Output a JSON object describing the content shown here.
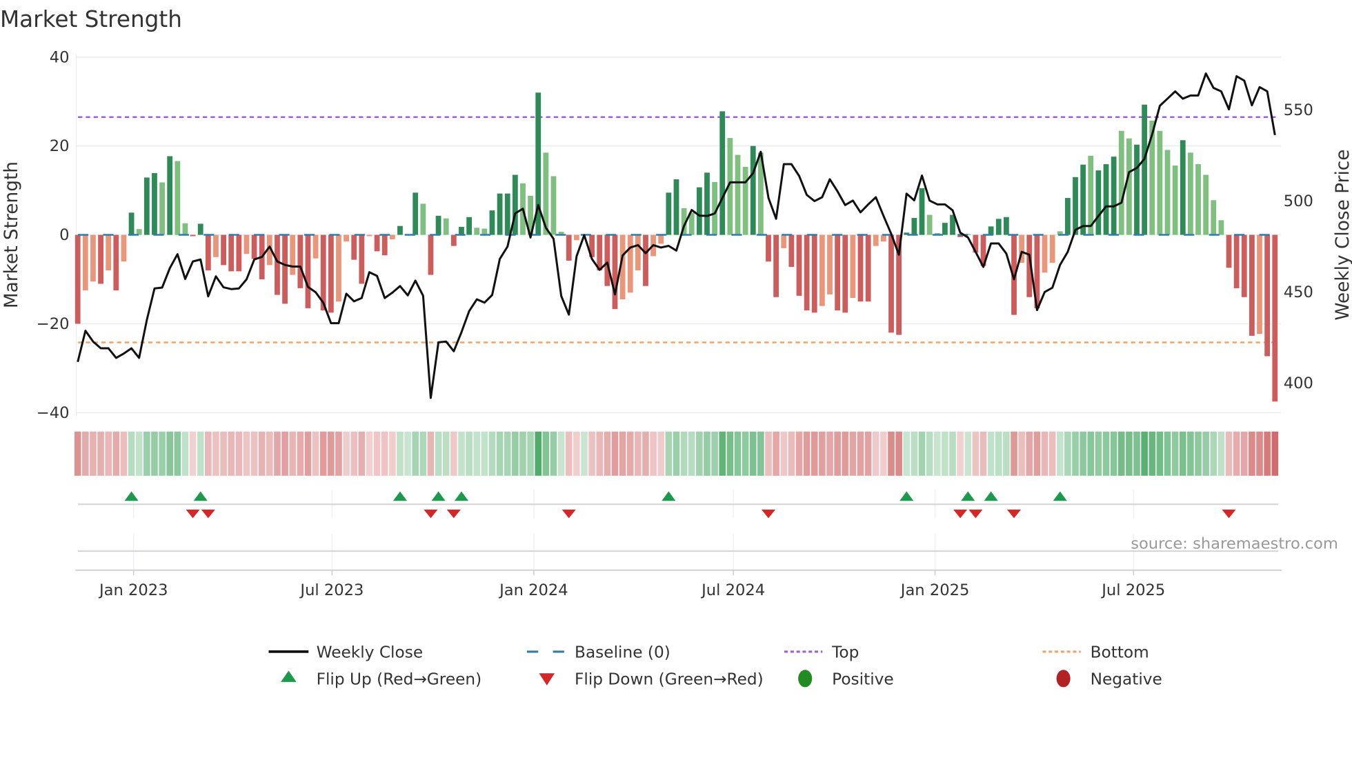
{
  "chart_data": {
    "type": "bar",
    "title": "Market Strength",
    "ylabel": "Market Strength",
    "y2label": "Weekly Close Price",
    "ylim": [
      -40,
      40
    ],
    "y2lim": [
      385,
      580
    ],
    "yticks": [
      40,
      20,
      0,
      -20,
      -40
    ],
    "y2ticks": [
      550,
      500,
      450,
      400
    ],
    "xticks": [
      {
        "label": "Jan 2023",
        "date": "2023-01-01"
      },
      {
        "label": "Jul 2023",
        "date": "2023-07-01"
      },
      {
        "label": "Jan 2024",
        "date": "2024-01-01"
      },
      {
        "label": "Jul 2024",
        "date": "2024-07-01"
      },
      {
        "label": "Jan 2025",
        "date": "2025-01-01"
      },
      {
        "label": "Jul 2025",
        "date": "2025-07-01"
      }
    ],
    "start_date": "2022-11-11",
    "interval": "weekly",
    "top_level": 26.5,
    "bottom_level": -24.2,
    "baseline": 0,
    "strength": [
      -20,
      -12.5,
      -10.5,
      -11,
      -8,
      -12.5,
      -6,
      5,
      1.3,
      12.9,
      13.9,
      11.8,
      17.7,
      16.6,
      2.6,
      -0.3,
      2.5,
      -8,
      -5,
      -6.8,
      -8.2,
      -8.2,
      -4.3,
      -5.4,
      -10,
      -6.8,
      -13.5,
      -15.5,
      -9,
      -12,
      -16.5,
      -5.3,
      -17,
      -17.5,
      -15,
      -1.5,
      -5.6,
      -11,
      -0.3,
      -3.7,
      -4.6,
      -1,
      2,
      0,
      9.5,
      7,
      -9,
      4.3,
      3.7,
      -2.5,
      1.8,
      4,
      1.6,
      1.4,
      5.5,
      9.3,
      9.3,
      13.5,
      11.6,
      8.8,
      32,
      18.5,
      13.2,
      0.7,
      -5.8,
      -1.2,
      0,
      -5,
      -8,
      -11.5,
      -16.7,
      -14.5,
      -13,
      -8,
      -11.5,
      -4.8,
      -2,
      9.5,
      12.5,
      6,
      5,
      10.7,
      14,
      11.9,
      27.8,
      21.8,
      18,
      15.3,
      20,
      18.5,
      -6,
      -14,
      -3,
      -7.2,
      -13.7,
      -17,
      -17.5,
      -16,
      -13.4,
      -17,
      -17.5,
      -14.2,
      -15,
      -15,
      -2.5,
      -1.5,
      -22,
      -22.5,
      0.5,
      3.8,
      10.5,
      4.5,
      0.4,
      2.7,
      4.5,
      -0.5,
      0.2,
      -4,
      -7,
      1.9,
      3.6,
      4,
      -18,
      -6.3,
      -14,
      -16.5,
      -8.5,
      -6.3,
      0.8,
      8.3,
      13,
      15.8,
      17.8,
      14.5,
      15.9,
      17.6,
      23.4,
      21.7,
      20.3,
      29.3,
      25.7,
      23.4,
      19.1,
      15.6,
      21.3,
      18.5,
      15.9,
      13.5,
      7.8,
      3.3,
      -7.4,
      -12,
      -14,
      -22.7,
      -22.3,
      -27.3,
      -37.5
    ],
    "strength_shade": "dlldldldlddldlldddldddlddlddlddlddllddlddldddlddldddllddddlldllldldddddllldllddllddldllldlddlddddllddlddlldddddlldddlddddddlddllldddldddllddlllldlllllddddldd",
    "weekly_close": [
      411.6,
      428.7,
      422.8,
      419.1,
      419.1,
      413.8,
      416.2,
      419.1,
      413.8,
      434.6,
      452,
      452.5,
      463.2,
      470.8,
      457.2,
      466.8,
      467.9,
      447.6,
      458.6,
      452.6,
      451.6,
      452,
      457,
      467.9,
      469.3,
      475,
      466.8,
      464.9,
      464,
      464,
      452.8,
      449.9,
      444.1,
      432.9,
      432.9,
      449.1,
      444.9,
      446.7,
      460.9,
      458.9,
      446.7,
      449.7,
      453.3,
      448.2,
      456.3,
      448,
      391.8,
      422.4,
      422.8,
      417.5,
      428,
      439.5,
      446,
      444.2,
      448.4,
      468.2,
      475,
      493.2,
      495.8,
      480,
      497.8,
      485.3,
      479.3,
      447.8,
      437.6,
      469.7,
      481.3,
      468.2,
      462.2,
      466.2,
      448.7,
      470.1,
      474.5,
      475.8,
      471.4,
      475.8,
      474.5,
      475.4,
      472.8,
      486.3,
      495.1,
      492,
      491.8,
      493.2,
      501.7,
      510.3,
      510.3,
      510.3,
      515.3,
      527.1,
      501.7,
      490.3,
      520.3,
      520.3,
      513.8,
      503.4,
      500,
      502.1,
      512,
      505.4,
      497.8,
      500.3,
      493.8,
      498.2,
      502.1,
      491.8,
      482,
      470.5,
      504.1,
      500.4,
      514,
      500.3,
      498.2,
      498.2,
      494.9,
      482.6,
      480,
      472.1,
      463.8,
      476.7,
      476.7,
      471.1,
      457,
      472.1,
      470.5,
      440.1,
      450,
      452.4,
      464.9,
      472.1,
      484.2,
      486.3,
      486.3,
      491.8,
      497.1,
      497.1,
      499.1,
      515.9,
      518.2,
      523.2,
      536.6,
      552.4,
      556.3,
      560.3,
      556.3,
      558,
      558,
      570.1,
      562.2,
      560.3,
      550.4,
      568.6,
      566.2,
      552.6,
      562.6,
      560.3,
      536.3
    ],
    "flip_up_weeks": [
      8,
      17,
      43,
      48,
      51,
      78,
      109,
      117,
      120,
      129
    ],
    "flip_down_weeks": [
      16,
      18,
      47,
      50,
      65,
      91,
      116,
      118,
      123,
      151
    ],
    "legend": [
      {
        "label": "Weekly Close",
        "kind": "line",
        "color": "#111111"
      },
      {
        "label": "Baseline (0)",
        "kind": "dash",
        "color": "#2e7bb0"
      },
      {
        "label": "Top",
        "kind": "dot",
        "color": "#9b5fe0"
      },
      {
        "label": "Bottom",
        "kind": "dot",
        "color": "#f2a366"
      },
      {
        "label": "Flip Up (Red→Green)",
        "kind": "up",
        "color": "#1a9a4a"
      },
      {
        "label": "Flip Down (Green→Red)",
        "kind": "down",
        "color": "#d62728"
      },
      {
        "label": "Positive",
        "kind": "circle",
        "color": "#228b22"
      },
      {
        "label": "Negative",
        "kind": "circle",
        "color": "#b22222"
      }
    ],
    "legend_placement": "bottom",
    "colors": {
      "pos_dark": "#2e8b57",
      "pos_light": "#7fbf7f",
      "neg_dark": "#cd5c5c",
      "neg_light": "#e9967a"
    }
  },
  "source": "source: sharemaestro.com"
}
